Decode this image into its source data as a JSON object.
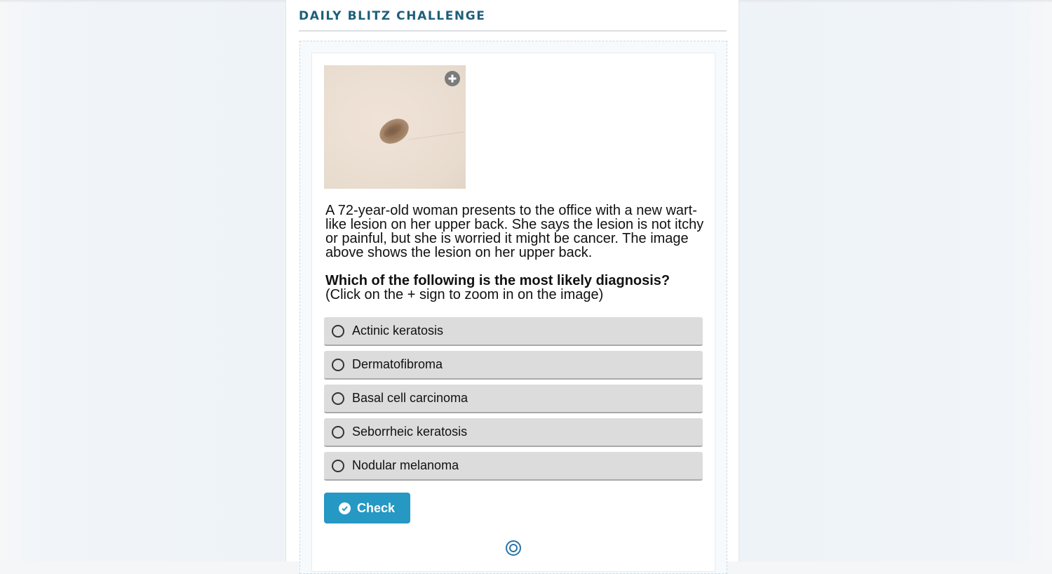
{
  "header": {
    "title": "DAILY BLITZ CHALLENGE"
  },
  "question": {
    "image_icon": "lesion-photo",
    "zoom_icon": "plus-circle-icon",
    "stem": "A 72-year-old woman presents to the office with a new wart-like lesion on her upper back. She says the lesion is not itchy or painful, but she is worried it might be cancer. The image above shows the lesion on her upper back.",
    "prompt": "Which of the following is the most likely diagnosis?",
    "hint": "(Click on the + sign to zoom in on the image)"
  },
  "options": [
    {
      "label": "Actinic keratosis"
    },
    {
      "label": "Dermatofibroma"
    },
    {
      "label": "Basal cell carcinoma"
    },
    {
      "label": "Seborrheic keratosis"
    },
    {
      "label": "Nodular melanoma"
    }
  ],
  "actions": {
    "check_label": "Check",
    "check_icon": "check-circle-icon"
  },
  "colors": {
    "title": "#1e5f7a",
    "accent": "#2598c4",
    "option_bg": "#dcdcdc"
  }
}
